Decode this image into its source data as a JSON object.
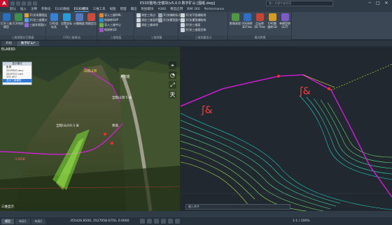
{
  "titlebar": {
    "logo": "A",
    "title": "ES3D整地(全模块)v5.0.0   数字矿山  [图纸.dwg]",
    "search_placeholder": "输入关键字或短语",
    "minimize": "─",
    "maximize": "□",
    "close": "✕"
  },
  "menu_tabs": [
    "默认",
    "插入",
    "注释",
    "参数化",
    "ES3D数据",
    "ES3D模块",
    "三维工具",
    "视图",
    "管理",
    "输出",
    "附加模块",
    "A360",
    "精选应用",
    "BIM 360",
    "Performance"
  ],
  "active_menu_tab": 5,
  "ribbon": {
    "panels": [
      {
        "title": "三维视图交互数据",
        "buttons": [
          "打开三维模型",
          "打开地形",
          "开/关场景图层",
          "开/关三维模式",
          "三维多视窗口"
        ]
      },
      {
        "title": "CAD三维联动",
        "buttons": [
          "CAD坐标系",
          "设置坐标系",
          "计算精度",
          "地图定位",
          "文本标注",
          "三维标注"
        ]
      },
      {
        "title": "三维图层",
        "buttons": [
          "导入三维KML",
          "地球转SHP",
          "导入三维中心",
          "地球转3D"
        ]
      },
      {
        "title": "三维测量",
        "buttons": [
          "测定三角点",
          "测定三维面积",
          "测定三维体积",
          "三维量测",
          "开/关辅助标注",
          "开/关模型图片"
        ]
      },
      {
        "title": "三维测量显示",
        "buttons": [
          "开/关平面辅助线",
          "开/关模型辅助线",
          "开/关三维面",
          "开/关三维面拉伸"
        ]
      },
      {
        "title": "格式转换",
        "buttons": [
          "影像高程",
          "OSGB转3DTiles",
          "点云转3D Tiles",
          "CAD数据转3D",
          "单模型转GLTF",
          "BIM转3D"
        ]
      }
    ]
  },
  "doc_tabs": [
    "开始",
    "数字矿山*"
  ],
  "active_doc_tab": 1,
  "left_view": {
    "header": "ELA83D",
    "popup": {
      "title": "显示模式",
      "items": [
        "影像",
        "2529541.wcy",
        "2529757.cad",
        "331.407",
        "显示三维模型"
      ],
      "selected_index": 4
    },
    "labels": [
      "白鹤山顶",
      "开挖面",
      "全程山顶 5 米",
      "全程(山)10.3 米",
      "余高",
      "-1.85米"
    ],
    "nav_buttons": [
      "⌖",
      "◔",
      "⤢",
      "天"
    ],
    "footer": "三维显示"
  },
  "right_view": {
    "command_placeholder": "键入命令"
  },
  "status": {
    "coords": "355426.8500, 2527058.6750, 0.0000",
    "model_tabs": [
      "模型",
      "布局1",
      "布局2"
    ],
    "active_model_tab": 0,
    "scale": "1:1 / 100%"
  },
  "colors": {
    "ribbon_bg": "#3b4754",
    "titlebar_bg": "#2f3b47",
    "accent": "#4aa3df",
    "route_magenta": "#e21be8",
    "contour_cyan": "#1ed3c6",
    "contour_green": "#7de23a"
  }
}
